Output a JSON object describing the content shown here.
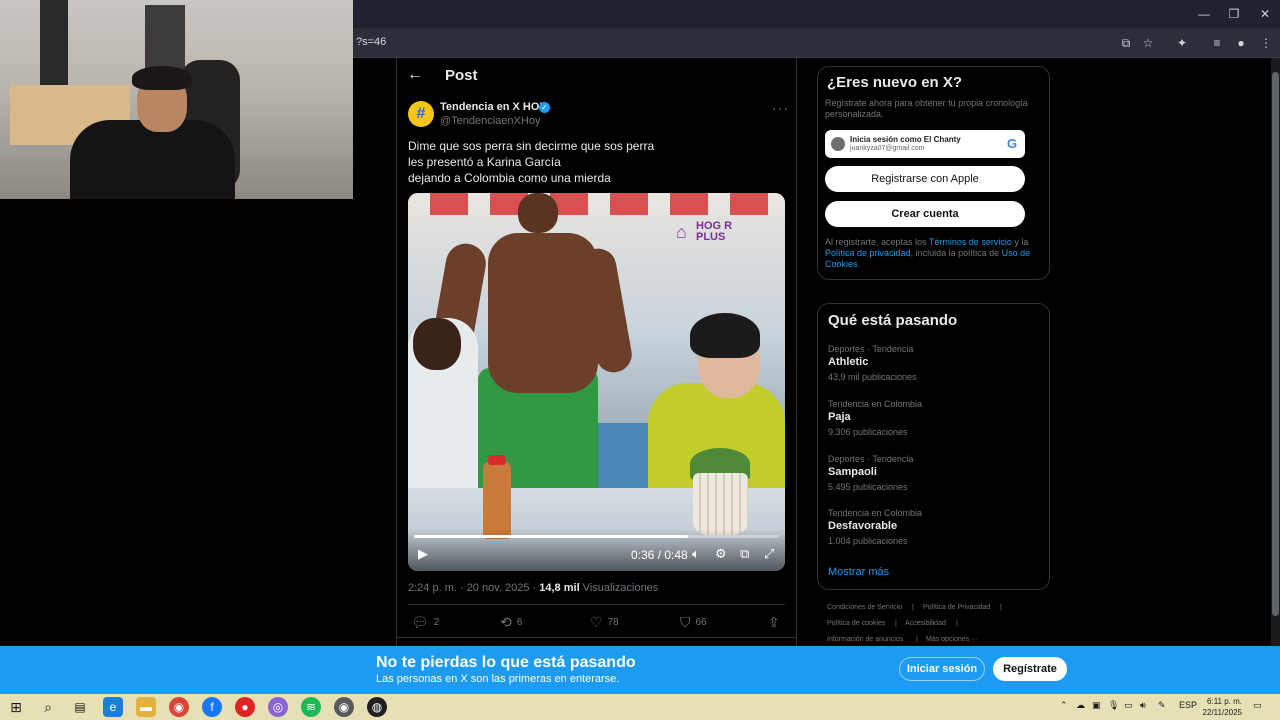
{
  "browser": {
    "url": "?s=46",
    "window_controls": [
      "—",
      "❐",
      "✕"
    ]
  },
  "post_header": {
    "title": "Post"
  },
  "tweet": {
    "author_name": "Tendencia en X HOY",
    "handle": "@TendenciaenXHoy",
    "text_lines": [
      "Dime que sos perra sin decirme que sos perra",
      "les presentó a Karina García",
      "dejando a Colombia como una mierda"
    ],
    "video": {
      "logo_line1": "HOG R",
      "logo_line2": "PLUS",
      "time": "0:36 / 0:48",
      "progress": 0.75
    },
    "meta": {
      "time": "2:24 p. m. · 20 nov. 2025 · ",
      "views_count": "14,8 mil",
      "views_label": " Visualizaciones"
    },
    "actions": {
      "replies": "2",
      "retweets": "6",
      "likes": "78",
      "bookmarks": "66"
    }
  },
  "signup_card": {
    "title": "¿Eres nuevo en X?",
    "subtitle": "Regístrate ahora para obtener tu propia cronología personalizada.",
    "google_name": "Inicia sesión como El Chanty",
    "google_email": "juankyza07@gmail.com",
    "apple_label": "Registrarse con Apple",
    "create_label": "Crear cuenta",
    "legal_prefix": "Al registrarte, aceptas los ",
    "legal_terms": "Términos de servicio",
    "legal_mid": " y la ",
    "legal_privacy": "Política de privacidad",
    "legal_mid2": ", incluida la política de ",
    "legal_cookies": "Uso de Cookies",
    "legal_end": "."
  },
  "trends": {
    "title": "Qué está pasando",
    "items": [
      {
        "category": "Deportes · Tendencia",
        "name": "Athletic",
        "count": "43,9 mil publicaciones"
      },
      {
        "category": "Tendencia en Colombia",
        "name": "Paja",
        "count": "9.306 publicaciones"
      },
      {
        "category": "Deportes · Tendencia",
        "name": "Sampaoli",
        "count": "5.495 publicaciones"
      },
      {
        "category": "Tendencia en Colombia",
        "name": "Desfavorable",
        "count": "1.004 publicaciones"
      }
    ],
    "show_more": "Mostrar más"
  },
  "footer_links": [
    "Condiciones de Servicio",
    "Política de Privacidad",
    "Política de cookies",
    "Accesibilidad",
    "Información de anuncios",
    "Más opciones ···"
  ],
  "banner": {
    "title": "No te pierdas lo que está pasando",
    "subtitle": "Las personas en X son las primeras en enterarse.",
    "login": "Iniciar sesión",
    "signup": "Regístrate"
  },
  "taskbar": {
    "lang": "ESP",
    "time": "6:11 p. m.",
    "date": "22/11/2025"
  },
  "colors": {
    "accent": "#1d9bf0",
    "banner": "#1d9bf0",
    "taskbar": "#e6e1b4"
  }
}
